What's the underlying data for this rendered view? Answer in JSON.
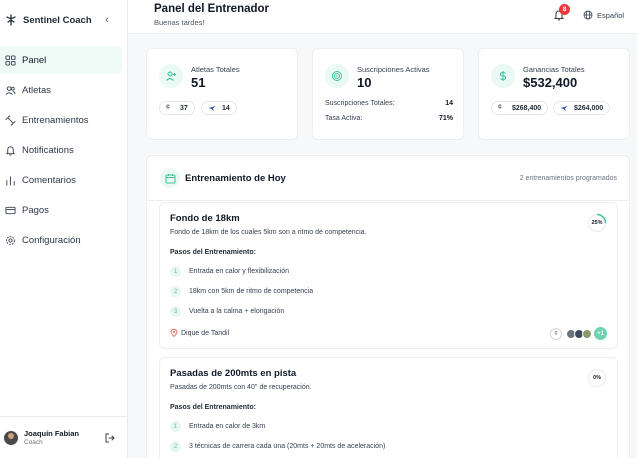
{
  "brand": {
    "name": "Sentinel Coach"
  },
  "sidebar": {
    "items": [
      {
        "label": "Panel",
        "icon": "grid-icon",
        "active": true
      },
      {
        "label": "Atletas",
        "icon": "users-icon",
        "active": false
      },
      {
        "label": "Entrenamientos",
        "icon": "dumbbell-icon",
        "active": false
      },
      {
        "label": "Notifications",
        "icon": "bell-icon",
        "active": false
      },
      {
        "label": "Comentarios",
        "icon": "bar-chart-icon",
        "active": false
      },
      {
        "label": "Pagos",
        "icon": "credit-card-icon",
        "active": false
      },
      {
        "label": "Configuración",
        "icon": "gear-icon",
        "active": false
      }
    ]
  },
  "user": {
    "name": "Joaquín Fabian",
    "role": "Coach"
  },
  "header": {
    "title": "Panel del Entrenador",
    "subtitle": "Buenas tardes!",
    "notification_count": "8",
    "language": "Español"
  },
  "stats": {
    "athletes": {
      "label": "Atletas Totales",
      "value": "51",
      "chip1": "37",
      "chip2": "14"
    },
    "subscriptions": {
      "label": "Suscripciones Activas",
      "value": "10",
      "total_label": "Suscripciones Totales:",
      "total_value": "14",
      "rate_label": "Tasa Activa:",
      "rate_value": "71%"
    },
    "earnings": {
      "label": "Ganancias Totales",
      "value": "$532,400",
      "chip1": "$268,400",
      "chip2": "$264,000"
    }
  },
  "today": {
    "title": "Entrenamiento de Hoy",
    "count": "2 entrenamientos programados",
    "steps_label": "Pasos del Entrenamiento:",
    "workouts": [
      {
        "title": "Fondo de 18km",
        "description": "Fondo de 18km de los cuales 5km son a ritmo de competencia.",
        "progress_label": "25%",
        "progress": 0.25,
        "steps": [
          {
            "n": "1",
            "text": "Entrada en calor y flexibilización"
          },
          {
            "n": "2",
            "text": "18km con 5km de ritmo de competencia"
          },
          {
            "n": "3",
            "text": "Vuelta a la calma + elongación"
          }
        ],
        "location": "Dique de Tandil",
        "more_athletes": "+1"
      },
      {
        "title": "Pasadas de 200mts en pista",
        "description": "Pasadas de 200mts con 40'' de recuperación.",
        "progress_label": "0%",
        "progress": 0,
        "steps": [
          {
            "n": "1",
            "text": "Entrada en calor de 3km"
          },
          {
            "n": "2",
            "text": "3 técnicas de carrera cada una (20mts + 20mts de aceleración)"
          }
        ]
      }
    ]
  },
  "colors": {
    "accent": "#3cc49b",
    "accent_soft": "#eaf9f3",
    "badge": "#e53e3e"
  }
}
